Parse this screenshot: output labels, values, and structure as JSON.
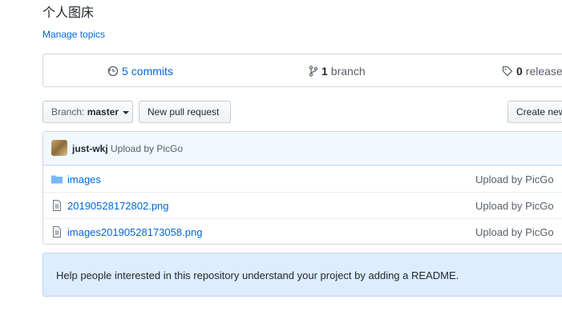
{
  "repo": {
    "description": "个人图床",
    "manage_topics": "Manage topics"
  },
  "summary": {
    "commits_num": "5",
    "commits_label": "commits",
    "branch_num": "1",
    "branch_label": "branch",
    "releases_num": "0",
    "releases_label": "releases"
  },
  "toolbar": {
    "branch_prefix": "Branch:",
    "branch_name": "master",
    "new_pull_request": "New pull request",
    "create_new": "Create new file"
  },
  "commit": {
    "author": "just-wkj",
    "message": "Upload by PicGo"
  },
  "files": [
    {
      "type": "folder",
      "name": "images",
      "message": "Upload by PicGo"
    },
    {
      "type": "file",
      "name": "20190528172802.png",
      "message": "Upload by PicGo"
    },
    {
      "type": "file",
      "name": "images20190528173058.png",
      "message": "Upload by PicGo"
    }
  ],
  "readme_prompt": "Help people interested in this repository understand your project by adding a README."
}
